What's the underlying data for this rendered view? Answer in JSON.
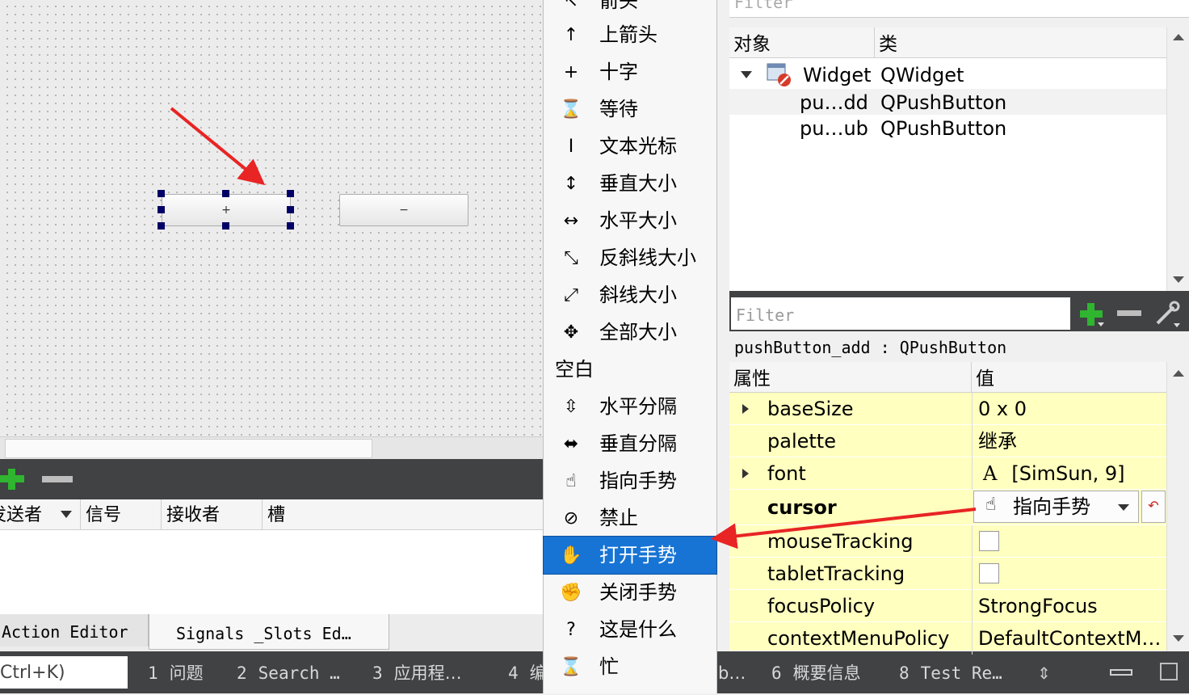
{
  "canvas": {
    "add_button_text": "+",
    "sub_button_text": "−"
  },
  "signal_slot_editor": {
    "columns": [
      "发送者",
      "信号",
      "接收者",
      "槽"
    ],
    "tabs": [
      "Action Editor",
      "Signals _Slots Ed…"
    ]
  },
  "status_bar": {
    "locator_text": "Ctrl+K)",
    "items": [
      {
        "num": "1",
        "label": "问题"
      },
      {
        "num": "2",
        "label": "Search …"
      },
      {
        "num": "3",
        "label": "应用程…"
      },
      {
        "num": "4",
        "label": "编"
      },
      {
        "num": "",
        "label": "b…"
      },
      {
        "num": "6",
        "label": "概要信息"
      },
      {
        "num": "8",
        "label": "Test Re…"
      }
    ]
  },
  "object_inspector": {
    "filter_placeholder": "Filter",
    "headers": [
      "对象",
      "类"
    ],
    "rows": [
      {
        "object": "Widget",
        "class": "QWidget"
      },
      {
        "object": "pu…dd",
        "class": "QPushButton"
      },
      {
        "object": "pu…ub",
        "class": "QPushButton"
      }
    ]
  },
  "property_editor": {
    "filter_placeholder": "Filter",
    "object_label": "pushButton_add : QPushButton",
    "headers": [
      "属性",
      "值"
    ],
    "rows": [
      {
        "name": "baseSize",
        "value": "0 x 0"
      },
      {
        "name": "palette",
        "value": "继承"
      },
      {
        "name": "font",
        "value": "[SimSun, 9]",
        "value_icon": "A"
      },
      {
        "name": "cursor",
        "value": "指向手势"
      },
      {
        "name": "mouseTracking",
        "value": ""
      },
      {
        "name": "tabletTracking",
        "value": ""
      },
      {
        "name": "focusPolicy",
        "value": "StrongFocus"
      },
      {
        "name": "contextMenuPolicy",
        "value": "DefaultContextM…"
      }
    ]
  },
  "cursor_menu": {
    "items": [
      {
        "label": "箭头",
        "icon": "arrow-cursor-icon",
        "glyph": "↖"
      },
      {
        "label": "上箭头",
        "icon": "up-arrow-cursor-icon",
        "glyph": "↑"
      },
      {
        "label": "十字",
        "icon": "cross-cursor-icon",
        "glyph": "+"
      },
      {
        "label": "等待",
        "icon": "hourglass-icon",
        "glyph": "⌛"
      },
      {
        "label": "文本光标",
        "icon": "ibeam-icon",
        "glyph": "I"
      },
      {
        "label": "垂直大小",
        "icon": "vertical-resize-icon",
        "glyph": "↕"
      },
      {
        "label": "水平大小",
        "icon": "horizontal-resize-icon",
        "glyph": "↔"
      },
      {
        "label": "反斜线大小",
        "icon": "diagonal-resize-backslash-icon",
        "glyph": "⤡"
      },
      {
        "label": "斜线大小",
        "icon": "diagonal-resize-slash-icon",
        "glyph": "⤢"
      },
      {
        "label": "全部大小",
        "icon": "move-all-icon",
        "glyph": "✥"
      }
    ],
    "section_label": "空白",
    "items2": [
      {
        "label": "水平分隔",
        "icon": "split-horizontal-icon",
        "glyph": "⇳"
      },
      {
        "label": "垂直分隔",
        "icon": "split-vertical-icon",
        "glyph": "⬌"
      },
      {
        "label": "指向手势",
        "icon": "pointing-hand-icon",
        "glyph": "☝"
      },
      {
        "label": "禁止",
        "icon": "forbidden-icon",
        "glyph": "⊘"
      },
      {
        "label": "打开手势",
        "icon": "open-hand-icon",
        "glyph": "✋"
      },
      {
        "label": "关闭手势",
        "icon": "closed-hand-icon",
        "glyph": "✊"
      },
      {
        "label": "这是什么",
        "icon": "whats-this-icon",
        "glyph": "?"
      },
      {
        "label": "忙",
        "icon": "busy-icon",
        "glyph": "⌛"
      }
    ],
    "selected_label": "打开手势"
  },
  "colors": {
    "selection": "#1874d4",
    "annotation_arrow": "#e82424",
    "property_bg": "#ffffbf"
  }
}
